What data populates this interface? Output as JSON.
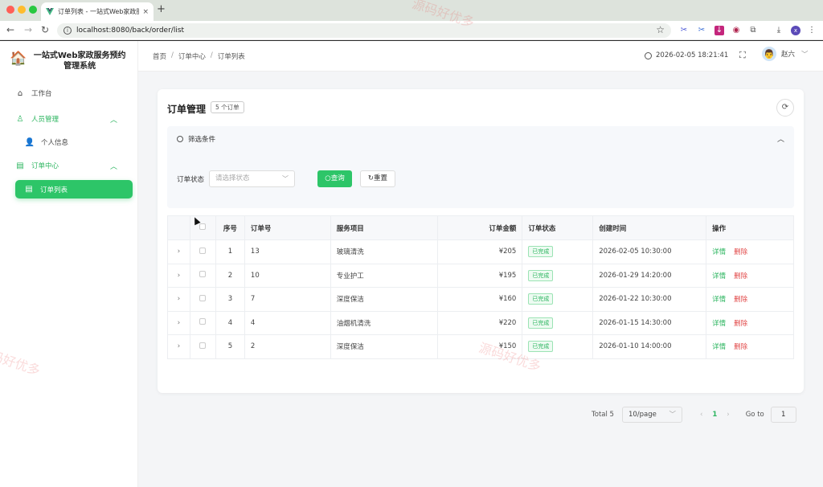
{
  "browser": {
    "tab_title": "订单列表 - 一站式Web家政服务",
    "tab_close": "×",
    "new_tab": "+",
    "url": "localhost:8080/back/order/list",
    "traffic_colors": [
      "#ff5f57",
      "#febc2e",
      "#28c840"
    ]
  },
  "sidebar": {
    "logo_icon": "house-icon",
    "system_name": "一站式Web家政服务预约管理系统",
    "items": [
      {
        "label": "工作台",
        "icon": "home-icon"
      },
      {
        "label": "人员管理",
        "icon": "user-icon"
      },
      {
        "label": "个人信息",
        "icon": "person-icon"
      },
      {
        "label": "订单中心",
        "icon": "document-icon"
      },
      {
        "label": "订单列表",
        "icon": "list-icon"
      }
    ]
  },
  "header": {
    "breadcrumb": [
      "首页",
      "订单中心",
      "订单列表"
    ],
    "datetime": "2026-02-05 18:21:41",
    "username": "赵六"
  },
  "main": {
    "title": "订单管理",
    "count_badge": "5 个订单",
    "filter_title": "筛选条件",
    "status_label": "订单状态",
    "status_placeholder": "请选择状态",
    "search_label": "查询",
    "reset_label": "重置",
    "columns": [
      "序号",
      "订单号",
      "服务项目",
      "订单金额",
      "订单状态",
      "创建时间",
      "操作"
    ],
    "rows": [
      {
        "index": "1",
        "order_no": "13",
        "service": "玻璃清洗",
        "amount": "¥205",
        "status": "已完成",
        "created": "2026-02-05 10:30:00"
      },
      {
        "index": "2",
        "order_no": "10",
        "service": "专业护工",
        "amount": "¥195",
        "status": "已完成",
        "created": "2026-01-29 14:20:00"
      },
      {
        "index": "3",
        "order_no": "7",
        "service": "深度保洁",
        "amount": "¥160",
        "status": "已完成",
        "created": "2026-01-22 10:30:00"
      },
      {
        "index": "4",
        "order_no": "4",
        "service": "油烟机清洗",
        "amount": "¥220",
        "status": "已完成",
        "created": "2026-01-15 14:30:00"
      },
      {
        "index": "5",
        "order_no": "2",
        "service": "深度保洁",
        "amount": "¥150",
        "status": "已完成",
        "created": "2026-01-10 14:00:00"
      }
    ],
    "op_detail": "详情",
    "op_delete": "删除",
    "pagination": {
      "total": "Total 5",
      "page_size": "10/page",
      "current": "1",
      "goto_label": "Go to",
      "goto_value": "1"
    }
  },
  "watermark": "源码好优多",
  "colors": {
    "accent": "#2dc568",
    "danger": "#e24a4a"
  }
}
